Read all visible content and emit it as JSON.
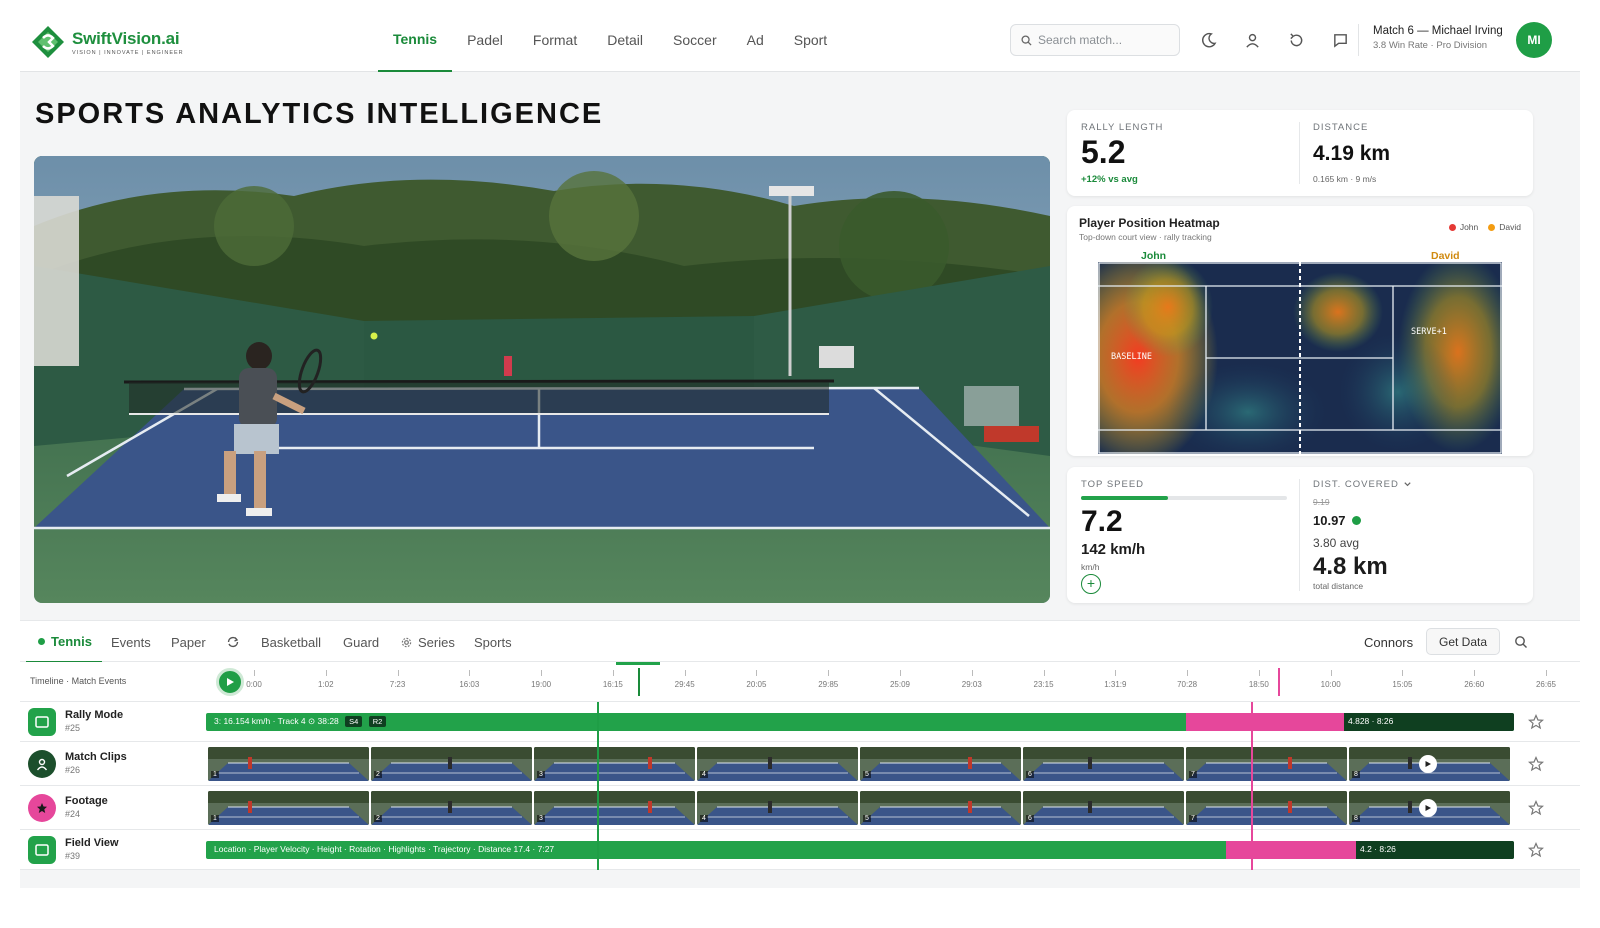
{
  "brand": {
    "name": "SwiftVision.ai",
    "tagline": "VISION | INNOVATE | ENGINEER"
  },
  "nav": {
    "items": [
      "Tennis",
      "Padel",
      "Format",
      "Detail",
      "Soccer",
      "Ad",
      "Sport"
    ],
    "active": "Tennis"
  },
  "search": {
    "placeholder": "Search match...",
    "value": ""
  },
  "toolbar_icons": [
    "moon-icon",
    "user-icon",
    "refresh-icon",
    "chat-icon"
  ],
  "user": {
    "title": "Match 6 — Michael Irving",
    "subtitle": "3.8 Win Rate · Pro Division",
    "initials": "MI"
  },
  "page": {
    "title": "SPORTS ANALYTICS INTELLIGENCE"
  },
  "stats_top": {
    "rally": {
      "label": "RALLY LENGTH",
      "value": "5.2",
      "note": "+12% vs avg"
    },
    "distance": {
      "label": "DISTANCE",
      "value": "4.19 km",
      "note": "0.165 km · 9 m/s"
    }
  },
  "heatmap": {
    "title": "Player Position Heatmap",
    "subtitle": "Top-down court view · rally tracking",
    "players": [
      {
        "name": "John",
        "color": "#e53935"
      },
      {
        "name": "David",
        "color": "#f39c12"
      }
    ],
    "zones": [
      "BASELINE",
      "SERVE+1"
    ]
  },
  "stats_bottom": {
    "speed": {
      "label": "TOP SPEED",
      "value": "7.2",
      "speed": "142 km/h",
      "unit": "km/h",
      "progress": 0.42
    },
    "dist": {
      "label": "DIST. COVERED",
      "strike": "9.19",
      "current": "10.97",
      "avg": "3.80 avg",
      "total": "4.8 km",
      "total_label": "total distance"
    }
  },
  "tabs": {
    "items": [
      "Tennis",
      "Events",
      "Paper",
      "Basketball",
      "Guard",
      "Series",
      "Sports"
    ],
    "right_label": "Connors",
    "action": "Get Data"
  },
  "timeline": {
    "label": "Timeline · Match Events",
    "ticks": [
      "0:00",
      "1:02",
      "7:23",
      "16:03",
      "19:00",
      "16:15",
      "29:45",
      "20:05",
      "29:85",
      "25:09",
      "29:03",
      "23:15",
      "1:31:9",
      "70:28",
      "18:50",
      "10:00",
      "15:05",
      "26:60",
      "26:65"
    ]
  },
  "tracks": [
    {
      "name": "Rally Mode",
      "id": "#25",
      "bar_text": "3: 16.154 km/h · Track 4   ⊙ 38:28",
      "pills": [
        "S4",
        "R2"
      ],
      "end_text": "4.828 · 8:26"
    },
    {
      "name": "Match Clips",
      "id": "#26"
    },
    {
      "name": "Footage",
      "id": "#24"
    },
    {
      "name": "Field View",
      "id": "#39",
      "bar_text": "Location   · Player Velocity   · Height   · Rotation   · Highlights   · Trajectory   · Distance     17.4 · 7:27",
      "end_text": "4.2 · 8:26"
    }
  ],
  "clip_numbers": [
    "1",
    "2",
    "3",
    "4",
    "5",
    "6",
    "7",
    "8"
  ],
  "colors": {
    "brand_green": "#1a8a3a",
    "bar_green": "#22a24a",
    "highlight_pink": "#e6479b",
    "dark_green": "#0f3f20"
  }
}
